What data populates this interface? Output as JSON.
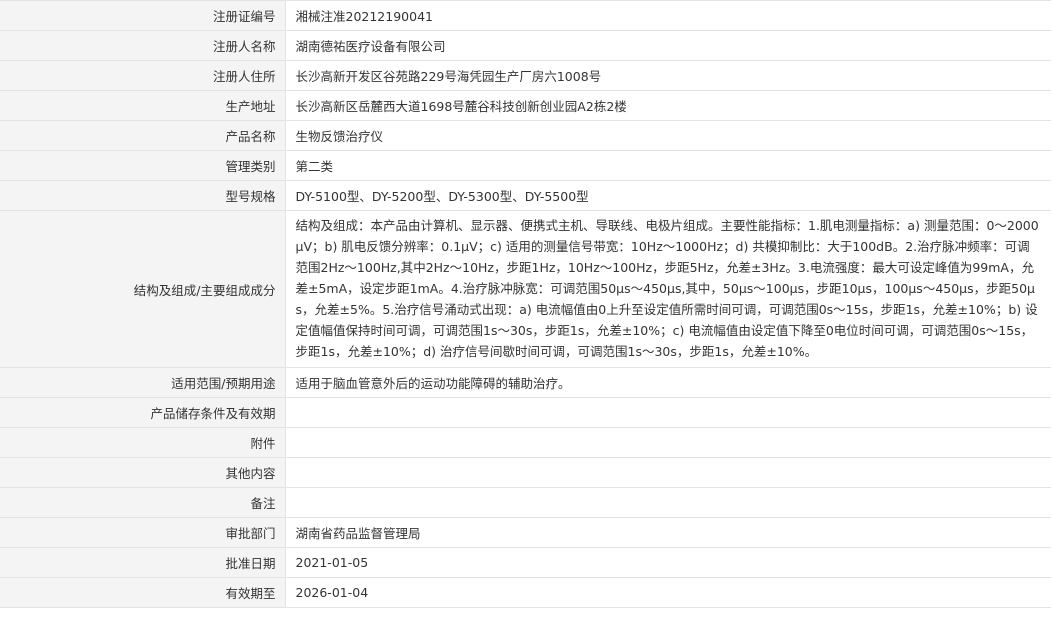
{
  "rows": [
    {
      "name": "registration-number",
      "label": "注册证编号",
      "value": "湘械注准20212190041"
    },
    {
      "name": "registrant-name",
      "label": "注册人名称",
      "value": "湖南德祐医疗设备有限公司"
    },
    {
      "name": "registrant-address",
      "label": "注册人住所",
      "value": "长沙高新开发区谷苑路229号海凭园生产厂房六1008号"
    },
    {
      "name": "production-address",
      "label": "生产地址",
      "value": "长沙高新区岳麓西大道1698号麓谷科技创新创业园A2栋2楼"
    },
    {
      "name": "product-name",
      "label": "产品名称",
      "value": "生物反馈治疗仪"
    },
    {
      "name": "management-category",
      "label": "管理类别",
      "value": "第二类"
    },
    {
      "name": "model-spec",
      "label": "型号规格",
      "value": "DY-5100型、DY-5200型、DY-5300型、DY-5500型"
    },
    {
      "name": "structure-composition",
      "label": "结构及组成/主要组成成分",
      "value": "结构及组成：本产品由计算机、显示器、便携式主机、导联线、电极片组成。主要性能指标：1.肌电测量指标：a) 测量范围：0～2000µV；b) 肌电反馈分辨率：0.1µV；c) 适用的测量信号带宽：10Hz～1000Hz；d) 共模抑制比：大于100dB。2.治疗脉冲频率：可调范围2Hz～100Hz,其中2Hz～10Hz，步距1Hz，10Hz～100Hz，步距5Hz，允差±3Hz。3.电流强度：最大可设定峰值为99mA，允差±5mA，设定步距1mA。4.治疗脉冲脉宽：可调范围50µs～450µs,其中，50µs～100µs，步距10µs，100µs～450µs，步距50µs，允差±5%。5.治疗信号涌动式出现：a) 电流幅值由0上升至设定值所需时间可调，可调范围0s～15s，步距1s，允差±10%；b) 设定值幅值保持时间可调，可调范围1s～30s，步距1s，允差±10%；c) 电流幅值由设定值下降至0电位时间可调，可调范围0s～15s，步距1s，允差±10%；d) 治疗信号间歇时间可调，可调范围1s～30s，步距1s，允差±10%。",
      "tall": true
    },
    {
      "name": "intended-use",
      "label": "适用范围/预期用途",
      "value": "适用于脑血管意外后的运动功能障碍的辅助治疗。"
    },
    {
      "name": "storage-conditions",
      "label": "产品储存条件及有效期",
      "value": ""
    },
    {
      "name": "attachment",
      "label": "附件",
      "value": ""
    },
    {
      "name": "other-content",
      "label": "其他内容",
      "value": ""
    },
    {
      "name": "remarks",
      "label": "备注",
      "value": ""
    },
    {
      "name": "approval-department",
      "label": "审批部门",
      "value": "湖南省药品监督管理局"
    },
    {
      "name": "approval-date",
      "label": "批准日期",
      "value": "2021-01-05"
    },
    {
      "name": "valid-until",
      "label": "有效期至",
      "value": "2026-01-04"
    }
  ]
}
